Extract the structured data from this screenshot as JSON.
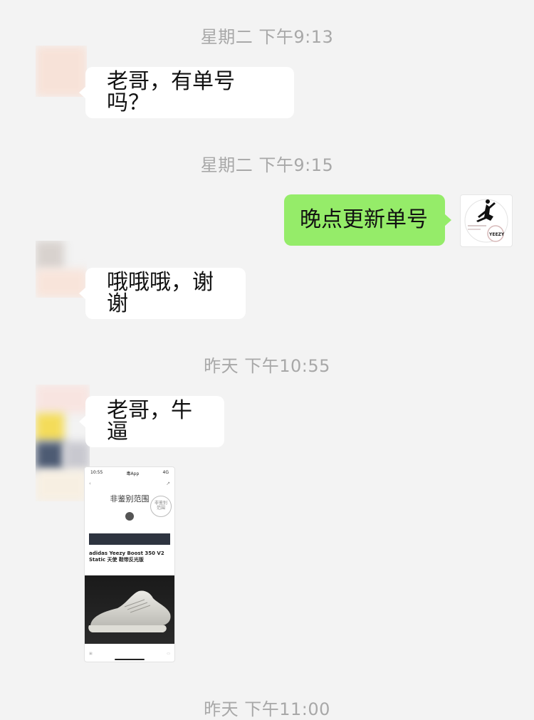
{
  "timestamps": {
    "t1": "星期二 下午9:13",
    "t2": "星期二 下午9:15",
    "t3": "昨天 下午10:55",
    "t4": "昨天 下午11:00"
  },
  "messages": {
    "m1": "老哥，有单号吗？",
    "m2": "晚点更新单号",
    "m3": "哦哦哦，谢谢",
    "m4": "老哥，牛逼"
  },
  "colors": {
    "background": "#f3f3f3",
    "incoming_bubble": "#ffffff",
    "outgoing_bubble": "#95ec69",
    "timestamp_text": "#a8a8a8"
  },
  "thumb": {
    "badge": "YEEZY",
    "icon": "jumpman-logo-icon"
  },
  "screenshot_card": {
    "time": "10:55",
    "app": "毒App",
    "title": "非鉴别范围",
    "stamp": "非鉴别\n范围",
    "product": "adidas Yeezy Boost 350 V2 Static 天使 鞋带反光版",
    "status_icons": "4G"
  }
}
